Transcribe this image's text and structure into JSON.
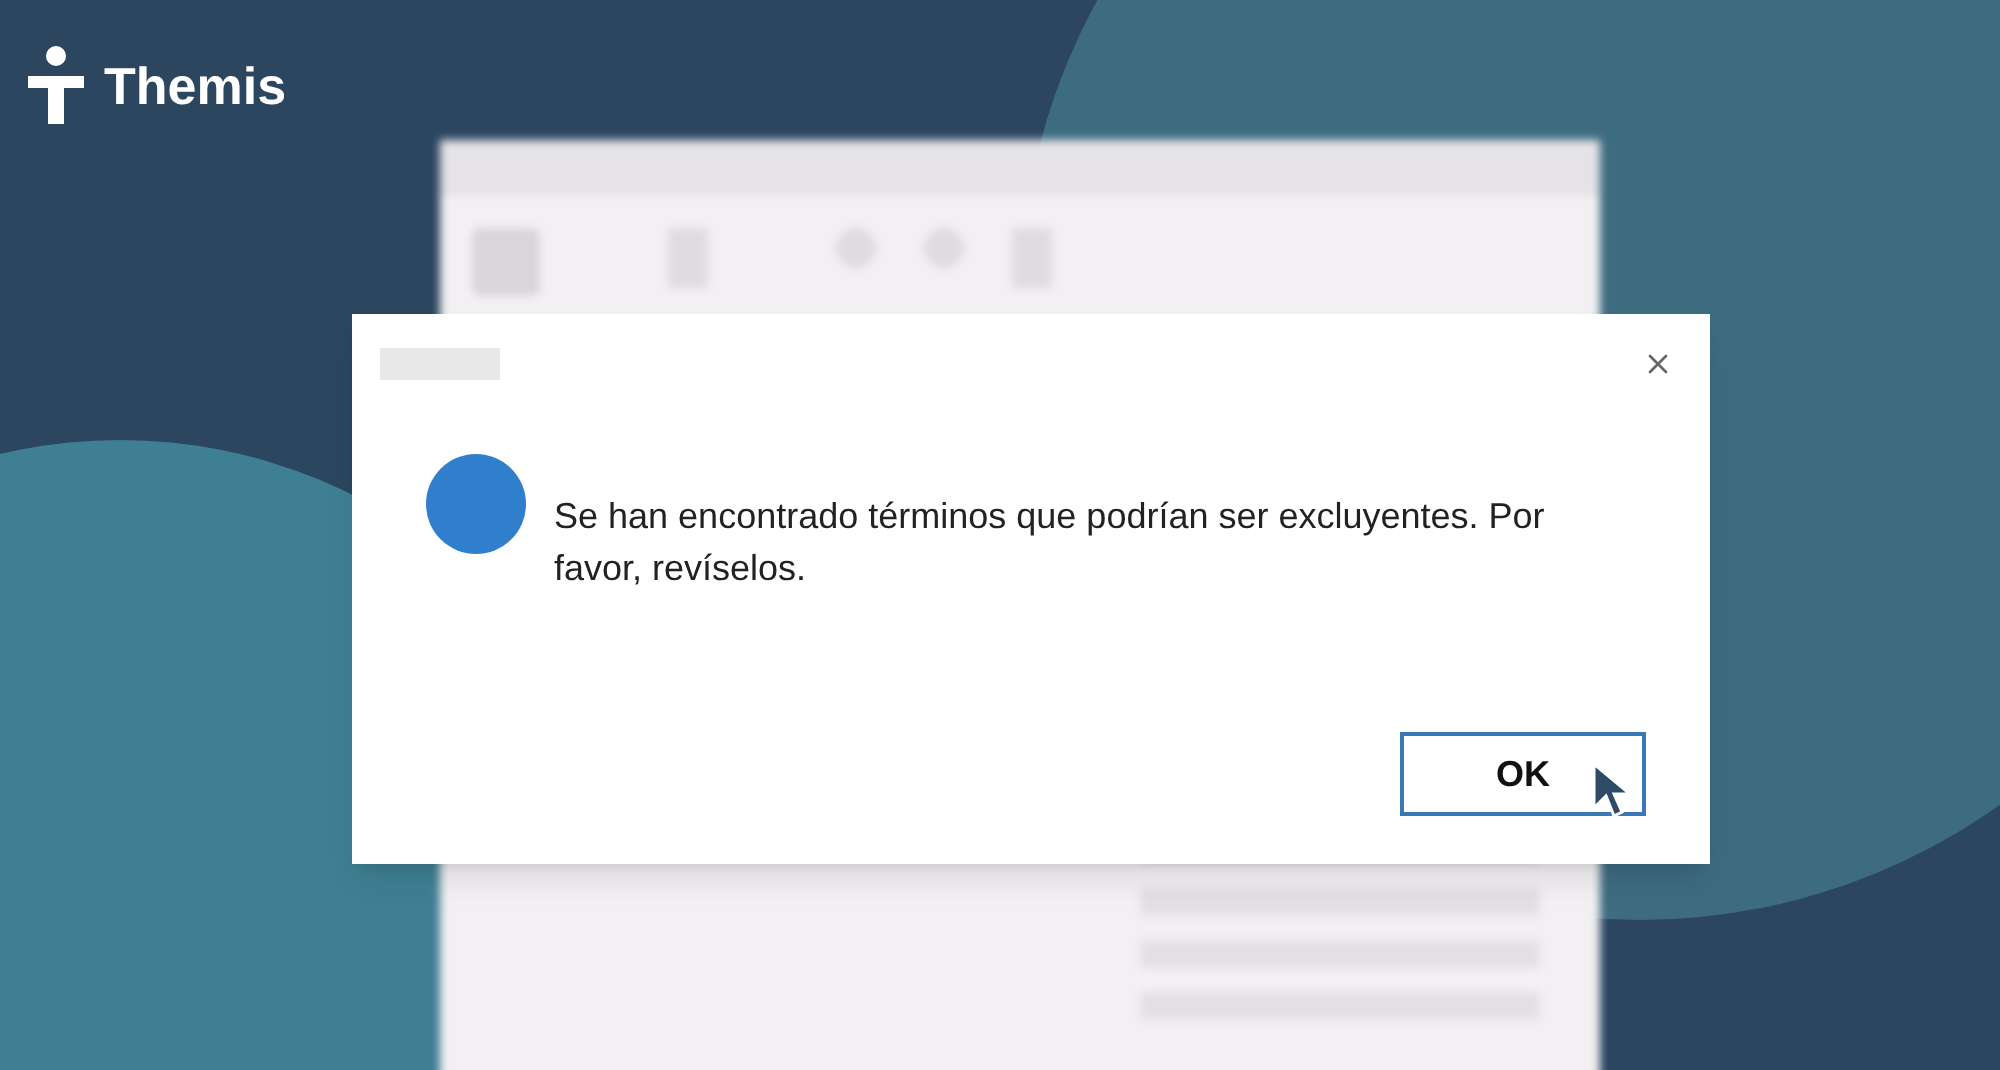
{
  "logo": {
    "text": "Themis"
  },
  "dialog": {
    "message": "Se han encontrado términos que podrían ser excluyentes. Por favor, revíselos.",
    "buttons": [
      {
        "label": "OK",
        "focused": true
      }
    ]
  }
}
